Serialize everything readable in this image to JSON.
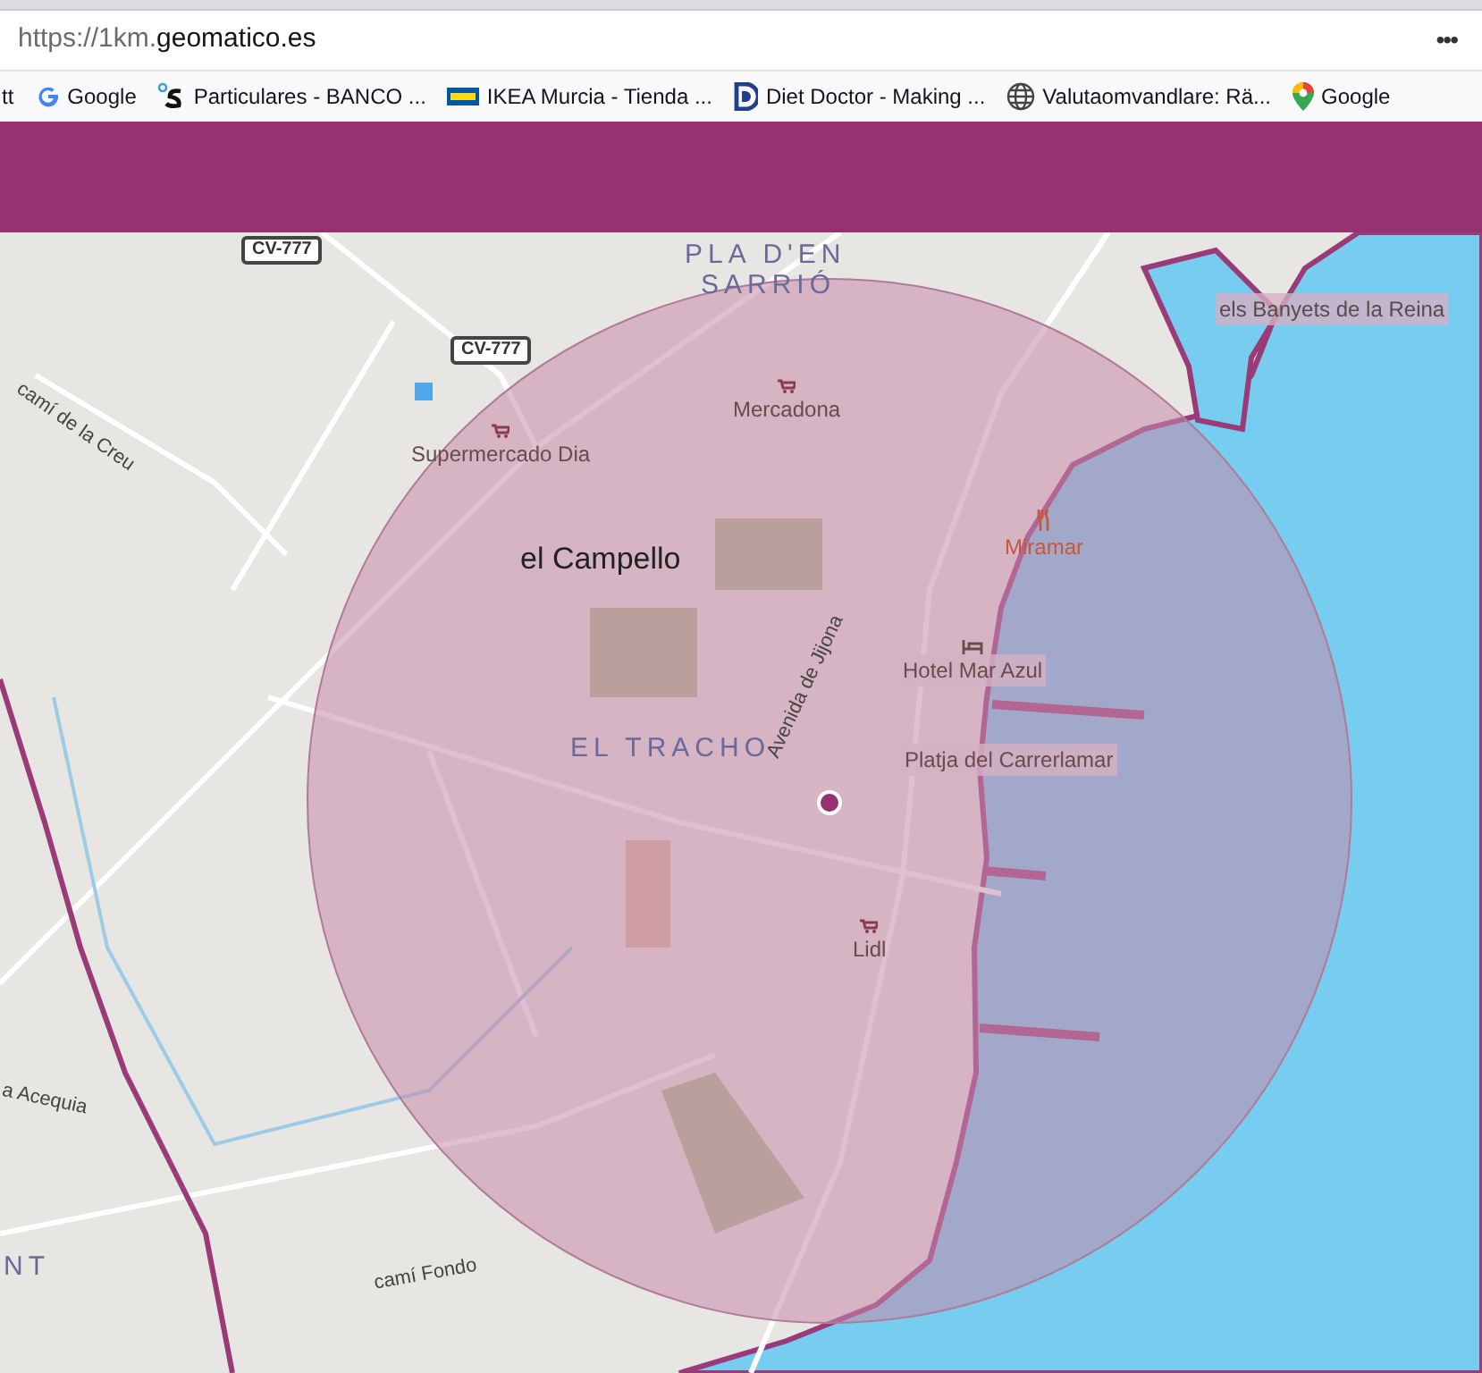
{
  "address_bar": {
    "url_scheme": "https://1km.",
    "url_domain": "geomatico.es",
    "menu": "•••"
  },
  "bookmarks": [
    {
      "kind": "plain",
      "label": "tt"
    },
    {
      "kind": "google",
      "label": "Google"
    },
    {
      "kind": "bank",
      "label": "Particulares - BANCO ..."
    },
    {
      "kind": "ikea",
      "label": "IKEA Murcia - Tienda ..."
    },
    {
      "kind": "dietdoctor",
      "label": "Diet Doctor - Making ..."
    },
    {
      "kind": "globe",
      "label": "Valutaomvandlare: Rä..."
    },
    {
      "kind": "maps",
      "label": "Google"
    }
  ],
  "map": {
    "labels": [
      {
        "kind": "shield",
        "text": "CV-777"
      },
      {
        "kind": "district",
        "text": "PLA D'EN"
      },
      {
        "kind": "district",
        "text": "SARRIÓ"
      },
      {
        "kind": "shield",
        "text": "CV-777"
      },
      {
        "kind": "street",
        "text": "camí de la Creu"
      },
      {
        "kind": "shop",
        "text": "Supermercado Dia"
      },
      {
        "kind": "shop",
        "text": "Mercadona"
      },
      {
        "kind": "poi",
        "text": "els Banyets de la Reina"
      },
      {
        "kind": "place",
        "text": "el Campello"
      },
      {
        "kind": "food",
        "text": "Miramar"
      },
      {
        "kind": "hotel",
        "text": "Hotel Mar Azul"
      },
      {
        "kind": "district",
        "text": "EL TRACHO"
      },
      {
        "kind": "street",
        "text": "Avenida de Jijona"
      },
      {
        "kind": "beach",
        "text": "Platja del Carrerlamar"
      },
      {
        "kind": "shop",
        "text": "Lidl"
      },
      {
        "kind": "street",
        "text": "a Acequia"
      },
      {
        "kind": "district",
        "text": "NT"
      },
      {
        "kind": "street",
        "text": "camí Fondo"
      }
    ]
  }
}
